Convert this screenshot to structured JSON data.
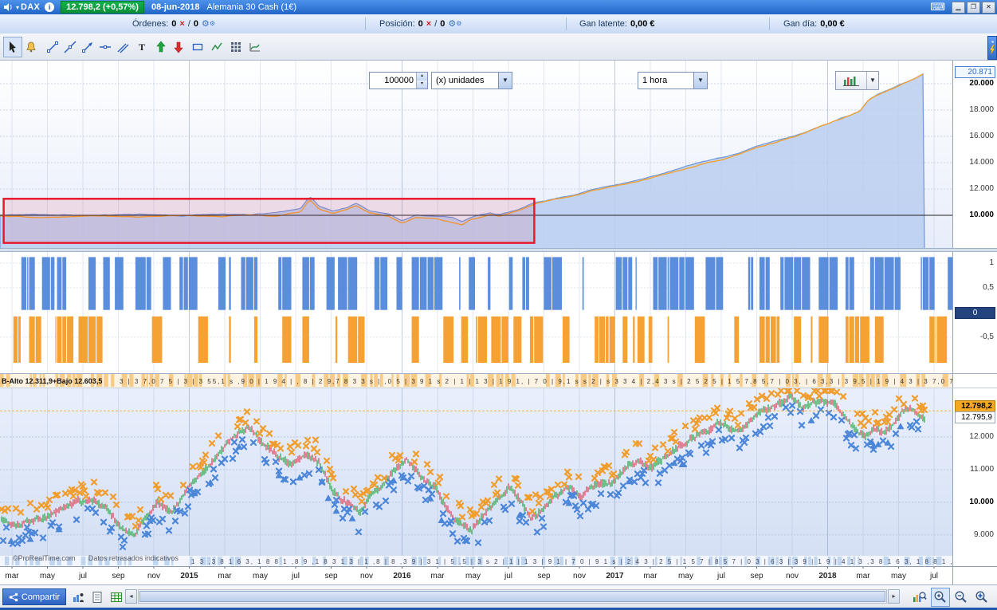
{
  "titlebar": {
    "instrument": "DAX",
    "price_badge": "12.798,2 (+0,57%)",
    "date": "08-jun-2018",
    "instrument_full": "Alemania 30 Cash (1€)"
  },
  "stats": {
    "ordenes_label": "Órdenes:",
    "ordenes_open": "0",
    "ordenes_pending": "0",
    "posicion_label": "Posición:",
    "posicion_open": "0",
    "posicion_pending": "0",
    "sep": "/",
    "gan_latente_label": "Gan latente:",
    "gan_latente": "0,00 €",
    "gan_dia_label": "Gan día:",
    "gan_dia": "0,00 €"
  },
  "toolbar": {
    "quantity": "100000",
    "units": "(x) unidades",
    "timeframe": "1 hora"
  },
  "info_strip": {
    "label": "B-Alto 12.311,9+Bajo 12.603,5",
    "ruler": "3 | 3 7,0 7 5 | 3 | 3 55,1 s ,9 0 | 1 9 4 | , 8 | 2 9,7 8 3 3 s | ,0 5 | 3 9 1 s 2 | 1 | 1 3 | 1 9 1, | 7 0 | 9,1 s s 2 | s 3 3 4 | 2,4 3 s | 2 5 2 5 | 1 5 7,8 5,7 | 0 3, | 6 3,3 | 3 9,5 | 1 9 | 4"
  },
  "bottom_ruler": "1 3 ,3 8 1 6 3, 1 8 8 1 ,8 9 ,1 8 3 1 3 | 1 ,8 | 8 ,3 9 | 3 1 | 5 ,5 | 3 s 2 | 1 | 1 3 | 9 1 | 7 0 | 9 1 s | 2 4 3 | 2 5 | 1 5 7 | 8 5 7 | 0 3 | 6 3 | 3 9 | 1 9 | 4",
  "watermark": {
    "brand": "©ProRealTime.com",
    "note": "Datos retrasados indicativos"
  },
  "bottom_bar": {
    "share": "Compartir"
  },
  "dates": {
    "labels": [
      {
        "t": "mar"
      },
      {
        "t": "may"
      },
      {
        "t": "jul"
      },
      {
        "t": "sep"
      },
      {
        "t": "nov"
      },
      {
        "t": "2015",
        "b": true
      },
      {
        "t": "mar"
      },
      {
        "t": "may"
      },
      {
        "t": "jul"
      },
      {
        "t": "sep"
      },
      {
        "t": "nov"
      },
      {
        "t": "2016",
        "b": true
      },
      {
        "t": "mar"
      },
      {
        "t": "may"
      },
      {
        "t": "jul"
      },
      {
        "t": "sep"
      },
      {
        "t": "nov"
      },
      {
        "t": "2017",
        "b": true
      },
      {
        "t": "mar"
      },
      {
        "t": "may"
      },
      {
        "t": "jul"
      },
      {
        "t": "sep"
      },
      {
        "t": "nov"
      },
      {
        "t": "2018",
        "b": true
      },
      {
        "t": "mar"
      },
      {
        "t": "may"
      },
      {
        "t": "jul"
      }
    ]
  },
  "chart_data": [
    {
      "id": "equity-curve",
      "type": "area",
      "y_ticks": [
        {
          "v": 20000,
          "label": "20.000",
          "bold": true
        },
        {
          "v": 18000,
          "label": "18.000"
        },
        {
          "v": 16000,
          "label": "16.000"
        },
        {
          "v": 14000,
          "label": "14.000"
        },
        {
          "v": 12000,
          "label": "12.000"
        },
        {
          "v": 10000,
          "label": "10.000",
          "bold": true
        }
      ],
      "y_domain": [
        7450,
        21820
      ],
      "current": {
        "value": 20871,
        "label": "20.871"
      },
      "baseline": 10000,
      "series": [
        {
          "name": "equity-area",
          "color": "#6f96d9",
          "fill": "#bacef0",
          "keypoints": [
            [
              0,
              10000
            ],
            [
              0.05,
              10050
            ],
            [
              0.1,
              9950
            ],
            [
              0.15,
              10100
            ],
            [
              0.2,
              9980
            ],
            [
              0.24,
              10150
            ],
            [
              0.27,
              10050
            ],
            [
              0.3,
              10200
            ],
            [
              0.325,
              10500
            ],
            [
              0.335,
              11450
            ],
            [
              0.345,
              10700
            ],
            [
              0.36,
              10300
            ],
            [
              0.375,
              10600
            ],
            [
              0.385,
              10900
            ],
            [
              0.4,
              10300
            ],
            [
              0.42,
              10150
            ],
            [
              0.435,
              9600
            ],
            [
              0.45,
              10050
            ],
            [
              0.47,
              10000
            ],
            [
              0.49,
              9900
            ],
            [
              0.5,
              9600
            ],
            [
              0.51,
              9900
            ],
            [
              0.53,
              10250
            ],
            [
              0.54,
              10100
            ],
            [
              0.56,
              10450
            ],
            [
              0.58,
              11000
            ],
            [
              0.6,
              11300
            ],
            [
              0.62,
              11600
            ],
            [
              0.64,
              12000
            ],
            [
              0.66,
              12300
            ],
            [
              0.68,
              12600
            ],
            [
              0.7,
              12900
            ],
            [
              0.72,
              13300
            ],
            [
              0.74,
              13700
            ],
            [
              0.76,
              14100
            ],
            [
              0.78,
              14400
            ],
            [
              0.8,
              14800
            ],
            [
              0.82,
              15300
            ],
            [
              0.84,
              15700
            ],
            [
              0.86,
              16100
            ],
            [
              0.875,
              16500
            ],
            [
              0.89,
              16900
            ],
            [
              0.905,
              17300
            ],
            [
              0.92,
              17700
            ],
            [
              0.93,
              18000
            ],
            [
              0.94,
              18900
            ],
            [
              0.95,
              19300
            ],
            [
              0.96,
              19600
            ],
            [
              0.97,
              19900
            ],
            [
              0.98,
              20200
            ],
            [
              0.99,
              20500
            ],
            [
              1,
              20871
            ]
          ]
        },
        {
          "name": "equity-line",
          "color": "#f0a232",
          "keypoints": [
            [
              0,
              9950
            ],
            [
              0.05,
              9900
            ],
            [
              0.1,
              10050
            ],
            [
              0.15,
              9950
            ],
            [
              0.2,
              10080
            ],
            [
              0.24,
              9950
            ],
            [
              0.27,
              10100
            ],
            [
              0.3,
              10000
            ],
            [
              0.325,
              10300
            ],
            [
              0.335,
              11200
            ],
            [
              0.345,
              10500
            ],
            [
              0.36,
              10150
            ],
            [
              0.375,
              10400
            ],
            [
              0.385,
              10700
            ],
            [
              0.4,
              10150
            ],
            [
              0.42,
              9950
            ],
            [
              0.435,
              9450
            ],
            [
              0.45,
              9900
            ],
            [
              0.47,
              9850
            ],
            [
              0.49,
              9500
            ],
            [
              0.5,
              9350
            ],
            [
              0.51,
              9750
            ],
            [
              0.53,
              10100
            ],
            [
              0.54,
              9950
            ],
            [
              0.56,
              10300
            ],
            [
              0.58,
              10850
            ],
            [
              0.6,
              11150
            ],
            [
              0.62,
              11450
            ],
            [
              0.64,
              11850
            ],
            [
              0.66,
              12150
            ],
            [
              0.68,
              12450
            ],
            [
              0.7,
              12750
            ],
            [
              0.72,
              13150
            ],
            [
              0.74,
              13550
            ],
            [
              0.76,
              13950
            ],
            [
              0.78,
              14250
            ],
            [
              0.8,
              14650
            ],
            [
              0.82,
              15150
            ],
            [
              0.84,
              15550
            ],
            [
              0.86,
              15950
            ],
            [
              0.875,
              16350
            ],
            [
              0.89,
              16750
            ],
            [
              0.905,
              17150
            ],
            [
              0.92,
              17550
            ],
            [
              0.93,
              17850
            ],
            [
              0.94,
              18750
            ],
            [
              0.95,
              19150
            ],
            [
              0.96,
              19450
            ],
            [
              0.97,
              19750
            ],
            [
              0.98,
              20050
            ],
            [
              0.99,
              20350
            ],
            [
              1,
              20700
            ]
          ]
        }
      ],
      "annotation_box": {
        "x0_frac": 0.004,
        "x1_frac": 0.578,
        "y_top": 11250,
        "y_bottom": 7900,
        "stroke": "#e8192c",
        "fill": "rgba(238,60,90,0.12)"
      }
    },
    {
      "id": "signal-histogram",
      "type": "bar",
      "y_ticks": [
        {
          "v": 1,
          "label": "1"
        },
        {
          "v": 0.5,
          "label": "0,5"
        },
        {
          "v": 0,
          "label": "0",
          "boxed": true
        },
        {
          "v": -0.5,
          "label": "-0,5"
        }
      ],
      "y_domain": [
        -1.23,
        1.24
      ],
      "up": {
        "color": "#5b8ddd",
        "from": 0.05,
        "to": 1.12
      },
      "down": {
        "color": "#f5a133",
        "from": -0.08,
        "to": -1.02
      },
      "seed": 20180608
    },
    {
      "id": "price-candles",
      "type": "candlestick",
      "y_ticks": [
        {
          "v": 12000,
          "label": "12.000"
        },
        {
          "v": 11000,
          "label": "11.000"
        },
        {
          "v": 10000,
          "label": "10.000",
          "bold": true
        },
        {
          "v": 9000,
          "label": "9.000"
        }
      ],
      "y_domain": [
        8360,
        13515
      ],
      "current": {
        "value": 12798.2,
        "label": "12.798,2",
        "color": "#f6a821"
      },
      "previous": {
        "value": 12795.9,
        "label": "12.795,9"
      },
      "up_color": "#3fae5a",
      "down_color": "#e0556a",
      "keypoints": [
        [
          0,
          9550
        ],
        [
          0.02,
          9400
        ],
        [
          0.04,
          9650
        ],
        [
          0.06,
          9750
        ],
        [
          0.08,
          9900
        ],
        [
          0.1,
          10000
        ],
        [
          0.115,
          9750
        ],
        [
          0.125,
          9350
        ],
        [
          0.135,
          9100
        ],
        [
          0.145,
          8900
        ],
        [
          0.155,
          9300
        ],
        [
          0.17,
          9900
        ],
        [
          0.185,
          9750
        ],
        [
          0.2,
          10250
        ],
        [
          0.215,
          10700
        ],
        [
          0.23,
          11200
        ],
        [
          0.245,
          11800
        ],
        [
          0.26,
          12200
        ],
        [
          0.27,
          12350
        ],
        [
          0.285,
          11900
        ],
        [
          0.3,
          11500
        ],
        [
          0.315,
          11200
        ],
        [
          0.33,
          11500
        ],
        [
          0.345,
          11100
        ],
        [
          0.36,
          10200
        ],
        [
          0.375,
          9900
        ],
        [
          0.39,
          9600
        ],
        [
          0.4,
          10050
        ],
        [
          0.415,
          10350
        ],
        [
          0.43,
          10900
        ],
        [
          0.44,
          11150
        ],
        [
          0.455,
          10650
        ],
        [
          0.47,
          10350
        ],
        [
          0.48,
          9750
        ],
        [
          0.495,
          9200
        ],
        [
          0.51,
          8900
        ],
        [
          0.525,
          9500
        ],
        [
          0.54,
          9950
        ],
        [
          0.55,
          10250
        ],
        [
          0.565,
          9850
        ],
        [
          0.575,
          9450
        ],
        [
          0.59,
          9900
        ],
        [
          0.6,
          10250
        ],
        [
          0.615,
          10550
        ],
        [
          0.63,
          10250
        ],
        [
          0.645,
          10650
        ],
        [
          0.66,
          10800
        ],
        [
          0.675,
          11200
        ],
        [
          0.69,
          11450
        ],
        [
          0.705,
          11300
        ],
        [
          0.72,
          11600
        ],
        [
          0.735,
          11950
        ],
        [
          0.75,
          12100
        ],
        [
          0.765,
          12400
        ],
        [
          0.78,
          12650
        ],
        [
          0.79,
          12450
        ],
        [
          0.8,
          12300
        ],
        [
          0.815,
          12600
        ],
        [
          0.83,
          12900
        ],
        [
          0.845,
          13100
        ],
        [
          0.855,
          13350
        ],
        [
          0.87,
          13100
        ],
        [
          0.885,
          13250
        ],
        [
          0.9,
          13050
        ],
        [
          0.915,
          12700
        ],
        [
          0.925,
          12350
        ],
        [
          0.935,
          12150
        ],
        [
          0.945,
          12500
        ],
        [
          0.955,
          12350
        ],
        [
          0.965,
          12600
        ],
        [
          0.975,
          12900
        ],
        [
          0.985,
          13100
        ],
        [
          0.99,
          12950
        ],
        [
          1,
          12798
        ]
      ],
      "markers": {
        "signal_up_color": "#f09d2e",
        "signal_down_color": "#4b86d8",
        "arrow_color": "#4b86d8"
      },
      "seed": 987654
    }
  ]
}
